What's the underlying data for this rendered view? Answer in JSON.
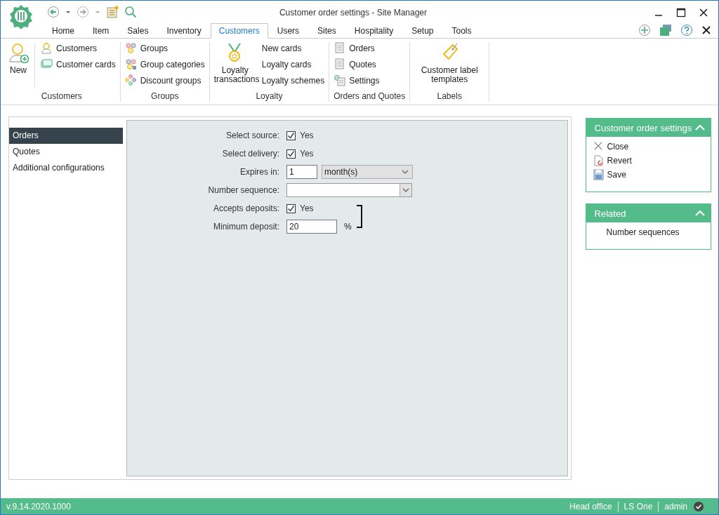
{
  "window": {
    "title": "Customer order settings - Site Manager"
  },
  "tabs": [
    {
      "label": "Home",
      "selected": false
    },
    {
      "label": "Item",
      "selected": false
    },
    {
      "label": "Sales",
      "selected": false
    },
    {
      "label": "Inventory",
      "selected": false
    },
    {
      "label": "Customers",
      "selected": true
    },
    {
      "label": "Users",
      "selected": false
    },
    {
      "label": "Sites",
      "selected": false
    },
    {
      "label": "Hospitality",
      "selected": false
    },
    {
      "label": "Setup",
      "selected": false
    },
    {
      "label": "Tools",
      "selected": false
    }
  ],
  "ribbon": {
    "groups": [
      {
        "label": "Customers",
        "items": [
          {
            "kind": "large",
            "label": "New"
          },
          {
            "kind": "small",
            "label": "Customers"
          },
          {
            "kind": "small",
            "label": "Customer cards"
          }
        ]
      },
      {
        "label": "Groups",
        "items": [
          {
            "kind": "small",
            "label": "Groups"
          },
          {
            "kind": "small",
            "label": "Group categories"
          },
          {
            "kind": "small",
            "label": "Discount groups"
          }
        ]
      },
      {
        "label": "Loyalty",
        "items": [
          {
            "kind": "large",
            "label": "Loyalty transactions"
          },
          {
            "kind": "small",
            "label": "New cards"
          },
          {
            "kind": "small",
            "label": "Loyalty cards"
          },
          {
            "kind": "small",
            "label": "Loyalty schemes"
          }
        ]
      },
      {
        "label": "Orders and Quotes",
        "items": [
          {
            "kind": "small",
            "label": "Orders"
          },
          {
            "kind": "small",
            "label": "Quotes"
          },
          {
            "kind": "small",
            "label": "Settings"
          }
        ]
      },
      {
        "label": "Labels",
        "items": [
          {
            "kind": "large",
            "label": "Customer label templates"
          }
        ]
      }
    ]
  },
  "sidebar": {
    "items": [
      {
        "label": "Orders",
        "selected": true
      },
      {
        "label": "Quotes",
        "selected": false
      },
      {
        "label": "Additional configurations",
        "selected": false
      }
    ]
  },
  "form": {
    "rows": [
      {
        "kind": "checkbox",
        "label": "Select source:",
        "checked": true,
        "text": "Yes"
      },
      {
        "kind": "checkbox",
        "label": "Select delivery:",
        "checked": true,
        "text": "Yes"
      },
      {
        "kind": "number_select",
        "label": "Expires in:",
        "value": "1",
        "option": "month(s)"
      },
      {
        "kind": "select",
        "label": "Number sequence:"
      },
      {
        "kind": "checkbox",
        "label": "Accepts deposits:",
        "checked": true,
        "text": "Yes"
      },
      {
        "kind": "number",
        "label": "Minimum deposit:",
        "value": "20",
        "unit": "%"
      }
    ]
  },
  "task_panels": [
    {
      "title": "Customer order settings",
      "expanded": true,
      "items": [
        {
          "kind": "close",
          "label": "Close"
        },
        {
          "kind": "revert",
          "label": "Revert"
        },
        {
          "kind": "save",
          "label": "Save"
        }
      ]
    },
    {
      "title": "Related",
      "expanded": true,
      "items": [
        {
          "kind": "link",
          "label": "Number sequences"
        }
      ]
    }
  ],
  "status_bar": {
    "version": "v.9.14.2020.1000",
    "items": [
      "Head office",
      "LS One",
      "admin"
    ]
  }
}
